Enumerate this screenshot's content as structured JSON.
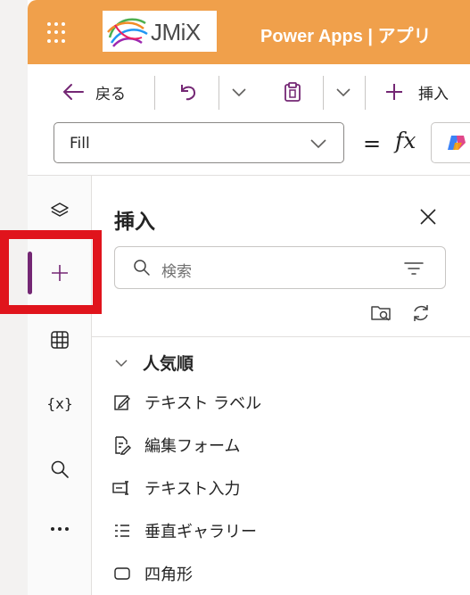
{
  "header": {
    "logo_text": "JMiX",
    "title": "Power Apps  |  アプリ"
  },
  "toolbar": {
    "back_label": "戻る",
    "insert_label": "挿入"
  },
  "formula_bar": {
    "property_value": "Fill",
    "equals": "=",
    "fx": "fx"
  },
  "rail": {
    "items": [
      {
        "name": "tree-view",
        "icon": "layers-icon"
      },
      {
        "name": "insert",
        "icon": "plus-icon",
        "active": true
      },
      {
        "name": "data",
        "icon": "table-icon"
      },
      {
        "name": "variables",
        "icon": "variables-icon",
        "text": "{x}"
      },
      {
        "name": "search",
        "icon": "search-icon"
      },
      {
        "name": "more",
        "icon": "more-icon"
      }
    ]
  },
  "panel": {
    "title": "挿入",
    "search_placeholder": "検索",
    "group_label": "人気順",
    "items": [
      {
        "label": "テキスト ラベル",
        "icon": "edit-icon"
      },
      {
        "label": "編集フォーム",
        "icon": "form-edit-icon"
      },
      {
        "label": "テキスト入力",
        "icon": "text-input-icon"
      },
      {
        "label": "垂直ギャラリー",
        "icon": "list-icon"
      },
      {
        "label": "四角形",
        "icon": "rectangle-icon"
      }
    ]
  },
  "colors": {
    "header_bg": "#f0a04b",
    "accent": "#742774",
    "highlight": "#e0141c"
  }
}
